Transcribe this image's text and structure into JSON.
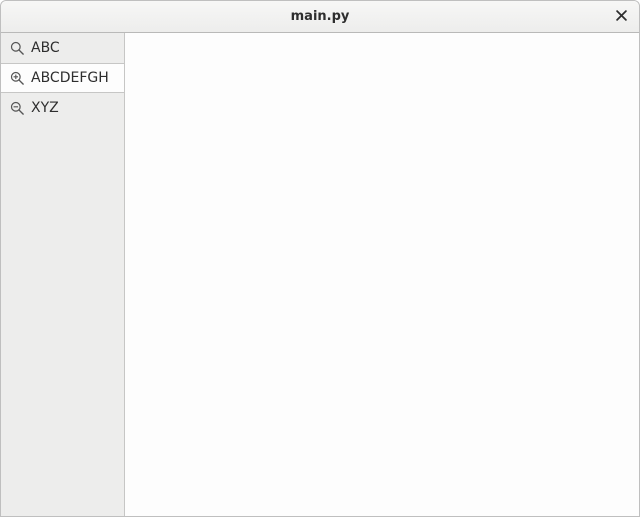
{
  "window": {
    "title": "main.py"
  },
  "sidebar": {
    "tabs": [
      {
        "label": "ABC",
        "icon": "zoom",
        "active": false
      },
      {
        "label": "ABCDEFGH",
        "icon": "zoom-in",
        "active": true
      },
      {
        "label": "XYZ",
        "icon": "zoom-out",
        "active": false
      }
    ]
  }
}
